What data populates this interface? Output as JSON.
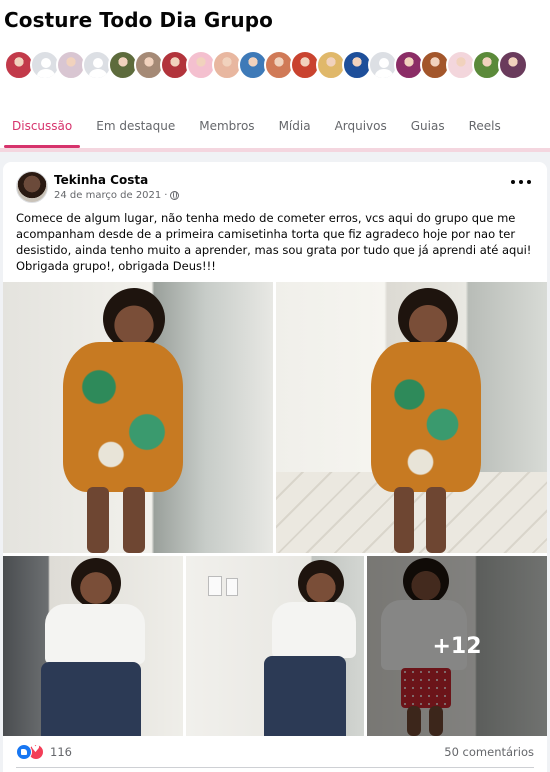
{
  "group": {
    "title": "Costure Todo Dia Grupo",
    "member_avatars": [
      {
        "color": "#c23a4a"
      },
      {
        "color": "placeholder"
      },
      {
        "color": "#d9c6d2"
      },
      {
        "color": "placeholder"
      },
      {
        "color": "#5d6b3c"
      },
      {
        "color": "#a58a76"
      },
      {
        "color": "#b2343c"
      },
      {
        "color": "#f4c0cf"
      },
      {
        "color": "#e8b7a0"
      },
      {
        "color": "#3e7ab8"
      },
      {
        "color": "#d07a57"
      },
      {
        "color": "#c9432f"
      },
      {
        "color": "#e0b86a"
      },
      {
        "color": "#1e4f9a"
      },
      {
        "color": "placeholder"
      },
      {
        "color": "#8b2d66"
      },
      {
        "color": "#a3562b"
      },
      {
        "color": "#f3d6dc"
      },
      {
        "color": "#5b8a3a"
      },
      {
        "color": "#6a3b5c"
      }
    ]
  },
  "tabs": [
    {
      "label": "Discussão",
      "active": true
    },
    {
      "label": "Em destaque",
      "active": false
    },
    {
      "label": "Membros",
      "active": false
    },
    {
      "label": "Mídia",
      "active": false
    },
    {
      "label": "Arquivos",
      "active": false
    },
    {
      "label": "Guias",
      "active": false
    },
    {
      "label": "Reels",
      "active": false
    }
  ],
  "post": {
    "author": "Tekinha Costa",
    "date": "24 de março de 2021",
    "separator": "·",
    "privacy_icon": "globe-icon",
    "text": "Comece de algum lugar, não tenha medo de cometer erros, vcs aqui do grupo que me acompanham desde de a primeira camisetinha torta que fiz agradeco hoje por nao ter desistido, ainda tenho muito a aprender, mas sou grata por tudo que já aprendi até aqui!\nObrigada grupo!, obrigada Deus!!!",
    "more_photos_label": "+12",
    "reaction_count": "116",
    "comment_count": "50 comentários"
  },
  "colors": {
    "accent": "#d6336c",
    "like": "#1877f2",
    "love": "#f33e58"
  }
}
